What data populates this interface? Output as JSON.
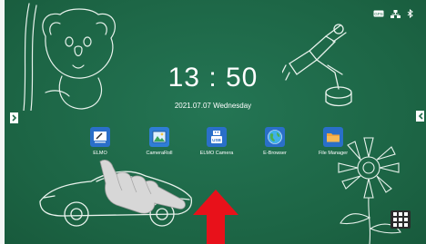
{
  "clock": {
    "time": "13 : 50",
    "date": "2021.07.07  Wednesday"
  },
  "status_bar": {
    "icons": [
      "gps-icon",
      "network-icon",
      "bluetooth-icon"
    ],
    "gps_label": "GPS"
  },
  "apps": [
    {
      "label": "ELMO",
      "icon": "whiteboard-icon"
    },
    {
      "label": "CameraRoll",
      "icon": "gallery-icon"
    },
    {
      "label": "ELMO Camera",
      "icon": "usb-camera-icon"
    },
    {
      "label": "E-Browser",
      "icon": "globe-icon"
    },
    {
      "label": "File Manager",
      "icon": "folder-icon"
    }
  ],
  "nav": {
    "left": "chevron-right-icon",
    "right": "chevron-left-icon",
    "app_drawer": "grid-icon"
  },
  "colors": {
    "board": "#1f6a4a",
    "chalk": "#e8f2ec",
    "arrow": "#e8111a",
    "icon_blue": "#2a6fc9"
  }
}
